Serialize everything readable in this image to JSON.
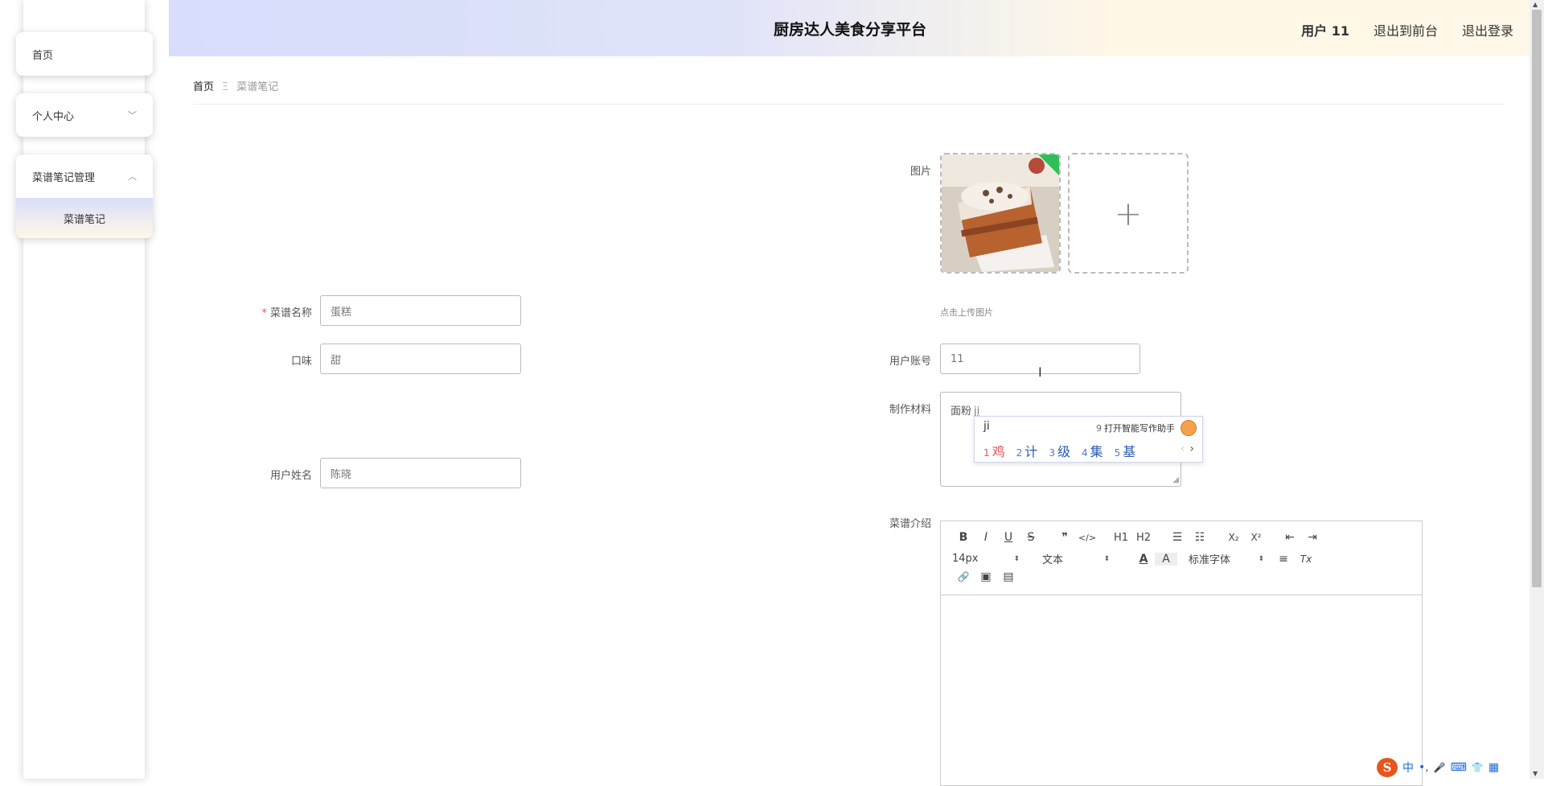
{
  "sidebar": {
    "home": "首页",
    "personal_center": "个人中心",
    "recipe_mgmt": "菜谱笔记管理",
    "recipe_notes": "菜谱笔记"
  },
  "header": {
    "title": "厨房达人美食分享平台",
    "user": "用户 11",
    "back_to_front": "退出到前台",
    "logout": "退出登录"
  },
  "breadcrumb": {
    "home": "首页",
    "separator": "Ξ",
    "current": "菜谱笔记"
  },
  "form": {
    "image_label": "图片",
    "upload_hint": "点击上传图片",
    "plus": "+",
    "recipe_name_label": "菜谱名称",
    "recipe_name_value": "蛋糕",
    "taste_label": "口味",
    "taste_value": "甜",
    "user_name_label": "用户姓名",
    "user_name_value": "陈晓",
    "account_label": "用户账号",
    "account_value": "11",
    "materials_label": "制作材料",
    "materials_value": "面粉",
    "materials_composing": "ji",
    "intro_label": "菜谱介绍"
  },
  "ime": {
    "pinyin": "ji",
    "assistant_num": "9",
    "assistant_text": "打开智能写作助手",
    "candidates": [
      {
        "n": "1",
        "c": "鸡"
      },
      {
        "n": "2",
        "c": "计"
      },
      {
        "n": "3",
        "c": "级"
      },
      {
        "n": "4",
        "c": "集"
      },
      {
        "n": "5",
        "c": "基"
      }
    ],
    "prev": "‹",
    "next": "›"
  },
  "editor": {
    "bold": "B",
    "italic": "I",
    "underline": "U",
    "strike": "S",
    "quote": "❞",
    "code": "</>",
    "h1": "H1",
    "h2": "H2",
    "ol": "☰",
    "ul": "☷",
    "sub": "X₂",
    "sup": "X²",
    "outdent": "⇤",
    "indent": "⇥",
    "size": "14px",
    "format": "文本",
    "text_color": "A",
    "bg_color": "A",
    "font": "标准字体",
    "align": "≡",
    "clear": "Tx",
    "link": "🔗",
    "image": "▣",
    "video": "▤"
  },
  "taskbar_ime": {
    "logo": "S",
    "lang": "中",
    "punct": "•,",
    "mic": "🎤",
    "keyboard": "⌨",
    "skin": "👕",
    "apps": "▦"
  }
}
